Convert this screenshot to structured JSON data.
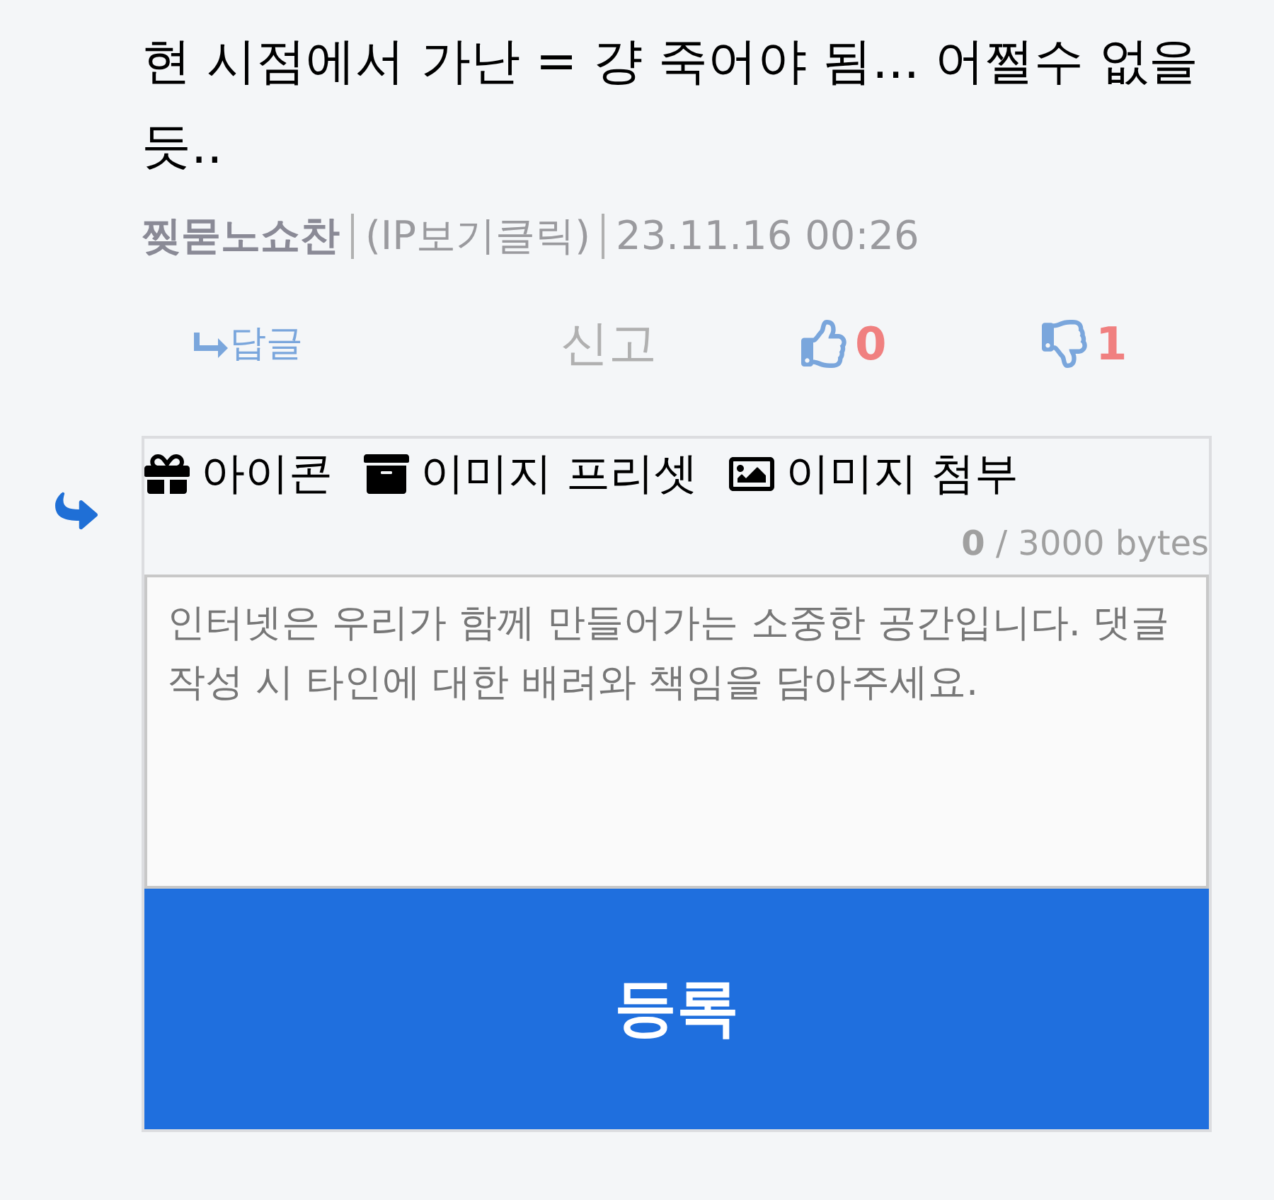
{
  "comment": {
    "text": "현 시점에서 가난 = 걍 죽어야 됨... 어쩔수 없을듯..",
    "author": "찢묻노쇼찬",
    "ip": "(IP보기클릭)",
    "date": "23.11.16 00:26"
  },
  "actions": {
    "reply": "답글",
    "report": "신고",
    "likes": "0",
    "dislikes": "1"
  },
  "editor": {
    "tools": [
      {
        "kind": "gift",
        "label": "아이콘"
      },
      {
        "kind": "archive",
        "label": "이미지 프리셋"
      },
      {
        "kind": "image",
        "label": "이미지 첨부"
      }
    ],
    "byte_count": "**0** / 3000 bytes",
    "placeholder": "인터넷은 우리가 함께 만들어가는 소중한 공간입니다. 댓글 작성 시 타인에 대한 배려와 책임을 담아주세요.",
    "submit": "등록"
  }
}
